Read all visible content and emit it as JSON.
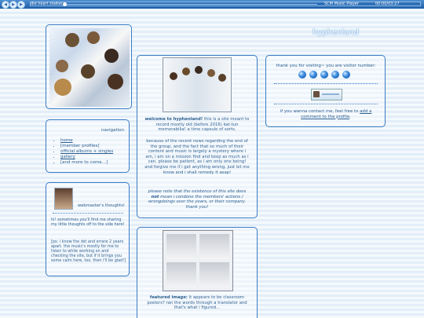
{
  "player": {
    "track": "die heart stalker",
    "app": "SCM Music Player",
    "time": "00:00/03:27"
  },
  "site_title": "hyphenland",
  "navigation": {
    "title": "navigation",
    "items": [
      "home",
      "[member profiles]",
      "official albums + singles",
      "gallery",
      "[and more to come...]"
    ]
  },
  "thoughts": {
    "title": "webmaster's thoughts!",
    "p1": "hi! sometimes you'll find me sharing my little thoughts off to the side here!",
    "p2": "[ps: i know the dst and errare 2 years apart. the music's mostly for me to listen to while working on and checking the site, but if it brings you some calm here, too, then i'll be glad!]"
  },
  "welcome": {
    "bold": "welcome to hyphenland!",
    "p1_rest": " this is a site meant to record mostly old (before 2016) kat-tun memorabilia! a time capsule of sorts.",
    "p2": "because of the recent news regarding the end of the group, and the fact that so much of their content and music is largely a mystery where i am, i am on a mission find and keep as much as i can. please be patient, as i am only one being! and forgive me if i get anything wrong, just let me know and i shall remedy it asap!",
    "p3a": "please note that the existence of this site does ",
    "p3b": "not",
    "p3c": " mean i condone the members' actions / wrongdoings over the years, or their company. thank you!"
  },
  "featured": {
    "bold": "featured image:",
    "text": " it appears to be classroom posters? ran the words through a translator and that's what i figured..."
  },
  "visitor": {
    "text": "thank you for visiting~ you are visitor number:",
    "digits_count": 5,
    "contact_a": "if you wanna contact me, feel free to ",
    "contact_link": "add a comment to the profile",
    "contact_end": "."
  }
}
